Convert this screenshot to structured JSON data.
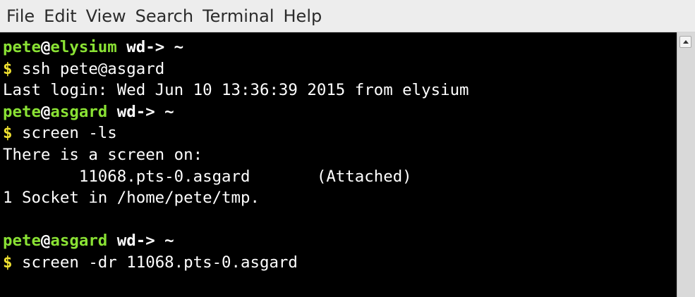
{
  "menu": {
    "file": "File",
    "edit": "Edit",
    "view": "View",
    "search": "Search",
    "terminal": "Terminal",
    "help": "Help"
  },
  "colors": {
    "background": "#000000",
    "user": "#8ae234",
    "host": "#8ae234",
    "dollar": "#f0e130",
    "text": "#ffffff"
  },
  "terminal": {
    "prompt1": {
      "user": "pete",
      "at": "@",
      "host": "elysium",
      "path": " wd-> ~"
    },
    "cmd1": {
      "dollar": "$",
      "text": " ssh pete@asgard"
    },
    "out1": "Last login: Wed Jun 10 13:36:39 2015 from elysium",
    "prompt2": {
      "user": "pete",
      "at": "@",
      "host": "asgard",
      "path": " wd-> ~"
    },
    "cmd2": {
      "dollar": "$",
      "text": " screen -ls"
    },
    "out2": "There is a screen on:",
    "out3": "        11068.pts-0.asgard       (Attached)",
    "out4": "1 Socket in /home/pete/tmp.",
    "out5": "",
    "prompt3": {
      "user": "pete",
      "at": "@",
      "host": "asgard",
      "path": " wd-> ~"
    },
    "cmd3": {
      "dollar": "$",
      "text": " screen -dr 11068.pts-0.asgard"
    }
  },
  "scrollbar": {
    "up_icon": "arrow-up-icon"
  }
}
